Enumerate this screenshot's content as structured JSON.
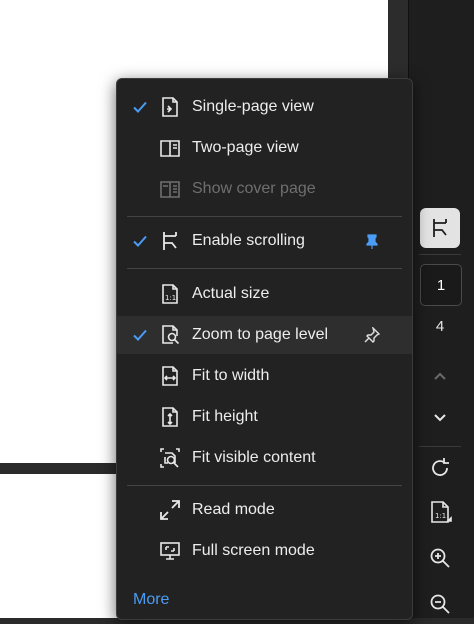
{
  "menu": {
    "items": [
      {
        "label": "Single-page view",
        "checked": true,
        "icon": "single-page-icon"
      },
      {
        "label": "Two-page view",
        "checked": false,
        "icon": "two-page-icon"
      },
      {
        "label": "Show cover page",
        "checked": false,
        "disabled": true,
        "icon": "cover-page-icon"
      },
      {
        "label": "Enable scrolling",
        "checked": true,
        "icon": "scroll-icon",
        "pinned": true
      },
      {
        "label": "Actual size",
        "checked": false,
        "icon": "actual-size-icon"
      },
      {
        "label": "Zoom to page level",
        "checked": true,
        "icon": "zoom-page-icon",
        "pin": true
      },
      {
        "label": "Fit to width",
        "checked": false,
        "icon": "fit-width-icon"
      },
      {
        "label": "Fit height",
        "checked": false,
        "icon": "fit-height-icon"
      },
      {
        "label": "Fit visible content",
        "checked": false,
        "icon": "fit-visible-icon"
      },
      {
        "label": "Read mode",
        "checked": false,
        "icon": "read-mode-icon"
      },
      {
        "label": "Full screen mode",
        "checked": false,
        "icon": "full-screen-icon"
      }
    ],
    "more_label": "More"
  },
  "rail": {
    "current_page": "1",
    "total_pages": "4"
  },
  "colors": {
    "accent": "#4b9cf5",
    "menu_bg": "#222222",
    "rail_bg": "#1e1e1e"
  }
}
